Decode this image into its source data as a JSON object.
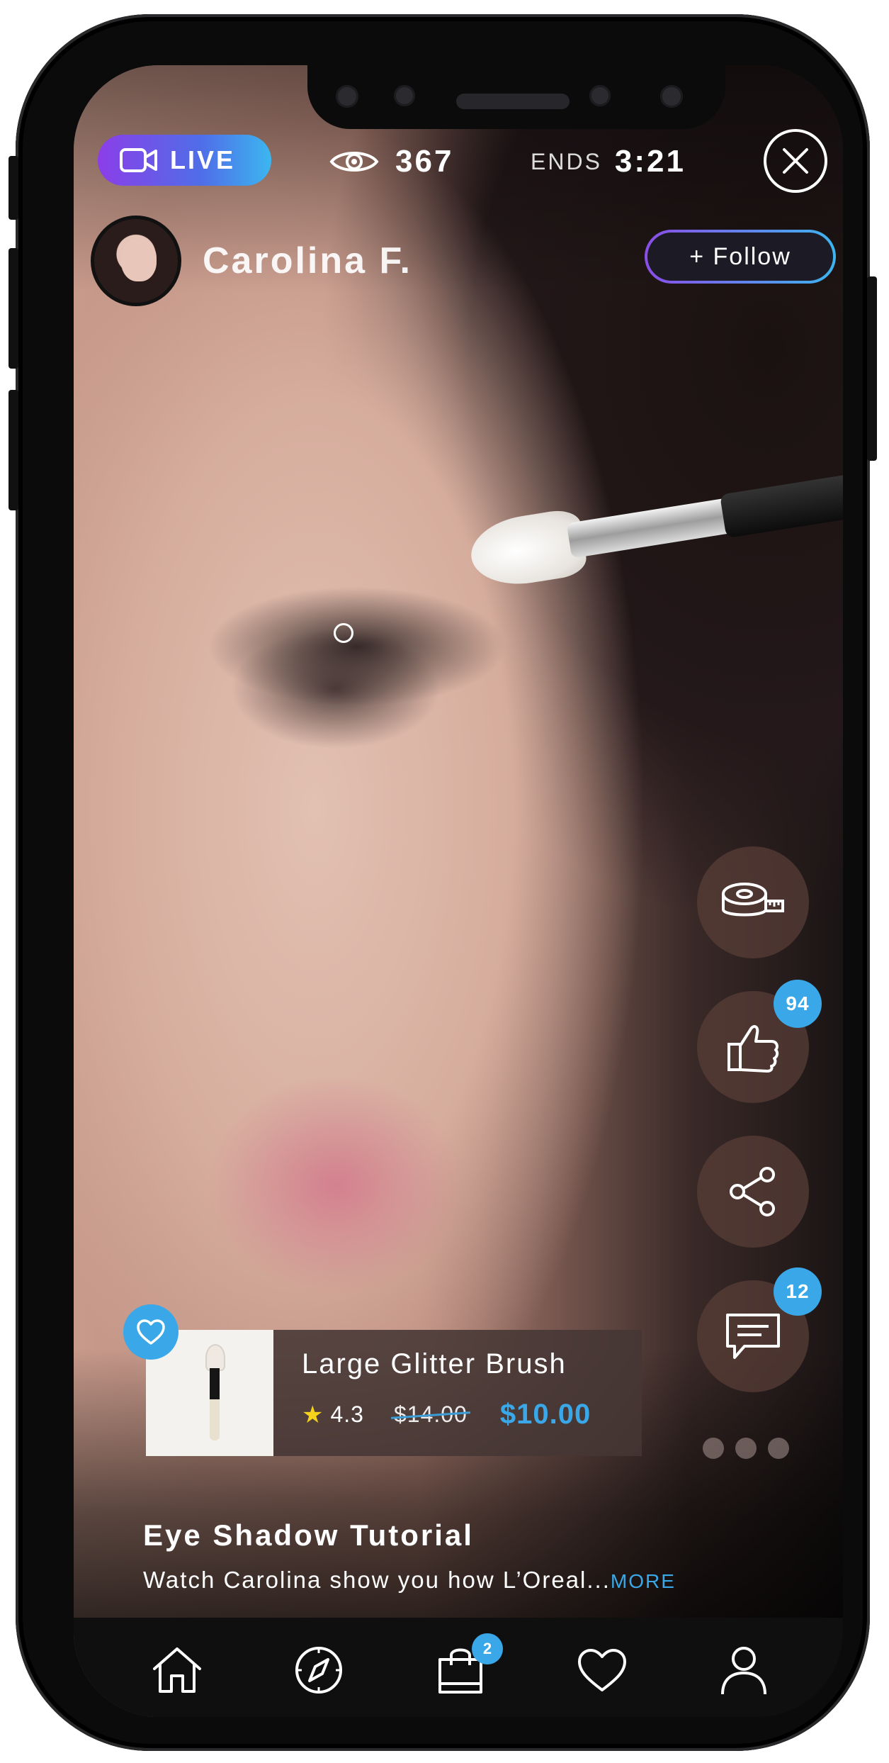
{
  "status": {
    "live_label": "LIVE",
    "viewer_count": "367",
    "ends_label": "ENDS",
    "ends_time": "3:21"
  },
  "host": {
    "name": "Carolina F.",
    "follow_label": "+ Follow"
  },
  "actions": {
    "likes_count": "94",
    "comments_count": "12"
  },
  "product": {
    "title": "Large Glitter Brush",
    "rating": "4.3",
    "old_price": "$14.00",
    "new_price": "$10.00"
  },
  "video": {
    "title": "Eye Shadow Tutorial",
    "description": "Watch Carolina show you how L’Oreal...",
    "more_label": "MORE"
  },
  "tabbar": {
    "cart_count": "2"
  },
  "colors": {
    "accent_blue": "#3aa8e8",
    "live_gradient_start": "#8b3ee8",
    "live_gradient_end": "#3cb6f0",
    "rating_star": "#f5d21c"
  },
  "icons": [
    "video-camera-icon",
    "eye-icon",
    "close-icon",
    "measuring-tape-icon",
    "thumbs-up-icon",
    "share-icon",
    "comment-icon",
    "heart-icon",
    "home-icon",
    "compass-icon",
    "shopping-bag-icon",
    "user-icon",
    "star-icon"
  ]
}
